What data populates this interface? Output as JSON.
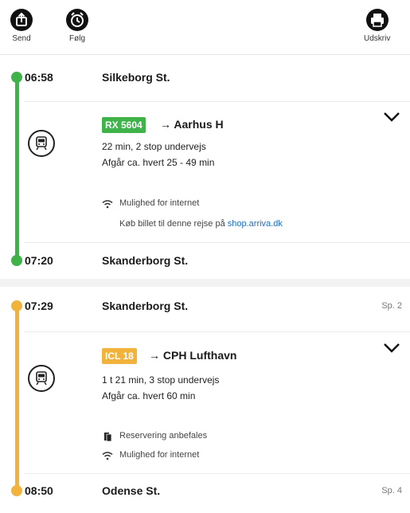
{
  "toolbar": {
    "send_label": "Send",
    "follow_label": "Følg",
    "print_label": "Udskriv"
  },
  "legs": [
    {
      "color": "#3fb34a",
      "dep_time": "06:58",
      "dep_station": "Silkeborg St.",
      "dep_track": "",
      "train_badge": "RX 5604",
      "arrow": "→",
      "destination": "Aarhus H",
      "duration": "22 min, 2 stop undervejs",
      "frequency": "Afgår ca. hvert 25 - 49 min",
      "notes": [
        "Mulighed for internet"
      ],
      "ticket_text": "Køb billet til denne rejse på ",
      "ticket_link": "shop.arriva.dk",
      "arr_time": "07:20",
      "arr_station": "Skanderborg St.",
      "arr_track": ""
    },
    {
      "color": "#f2b33d",
      "dep_time": "07:29",
      "dep_station": "Skanderborg St.",
      "dep_track": "Sp. 2",
      "train_badge": "ICL 18",
      "arrow": "→",
      "destination": "CPH Lufthavn",
      "duration": "1 t 21 min, 3 stop undervejs",
      "frequency": "Afgår ca. hvert 60 min",
      "notes": [
        "Reservering anbefales",
        "Mulighed for internet"
      ],
      "arr_time": "08:50",
      "arr_station": "Odense St.",
      "arr_track": "Sp. 4"
    }
  ]
}
